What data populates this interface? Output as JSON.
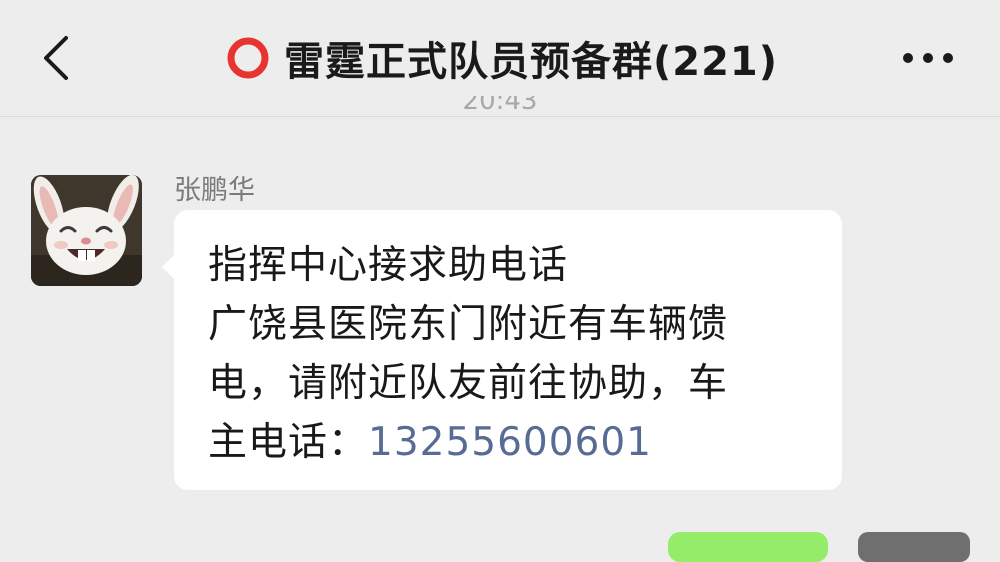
{
  "header": {
    "title": "雷霆正式队员预备群(221)",
    "back_icon": "chevron-left-icon",
    "title_icon": "red-ring-icon",
    "more_icon": "more-dots-icon",
    "accent_color": "#e8342e"
  },
  "timestamp_fragment": "20:43",
  "message": {
    "sender": "张鹏华",
    "avatar_icon": "rabbit-avatar-icon",
    "lines": [
      "指挥中心接求助电话",
      "广饶县医院东门附近有车辆馈",
      "电，请附近队友前往协助，车"
    ],
    "last_line_prefix": "主电话：",
    "phone": "13255600601",
    "link_color": "#576b95"
  },
  "next_message": {
    "bubble_color": "#95ec69"
  }
}
